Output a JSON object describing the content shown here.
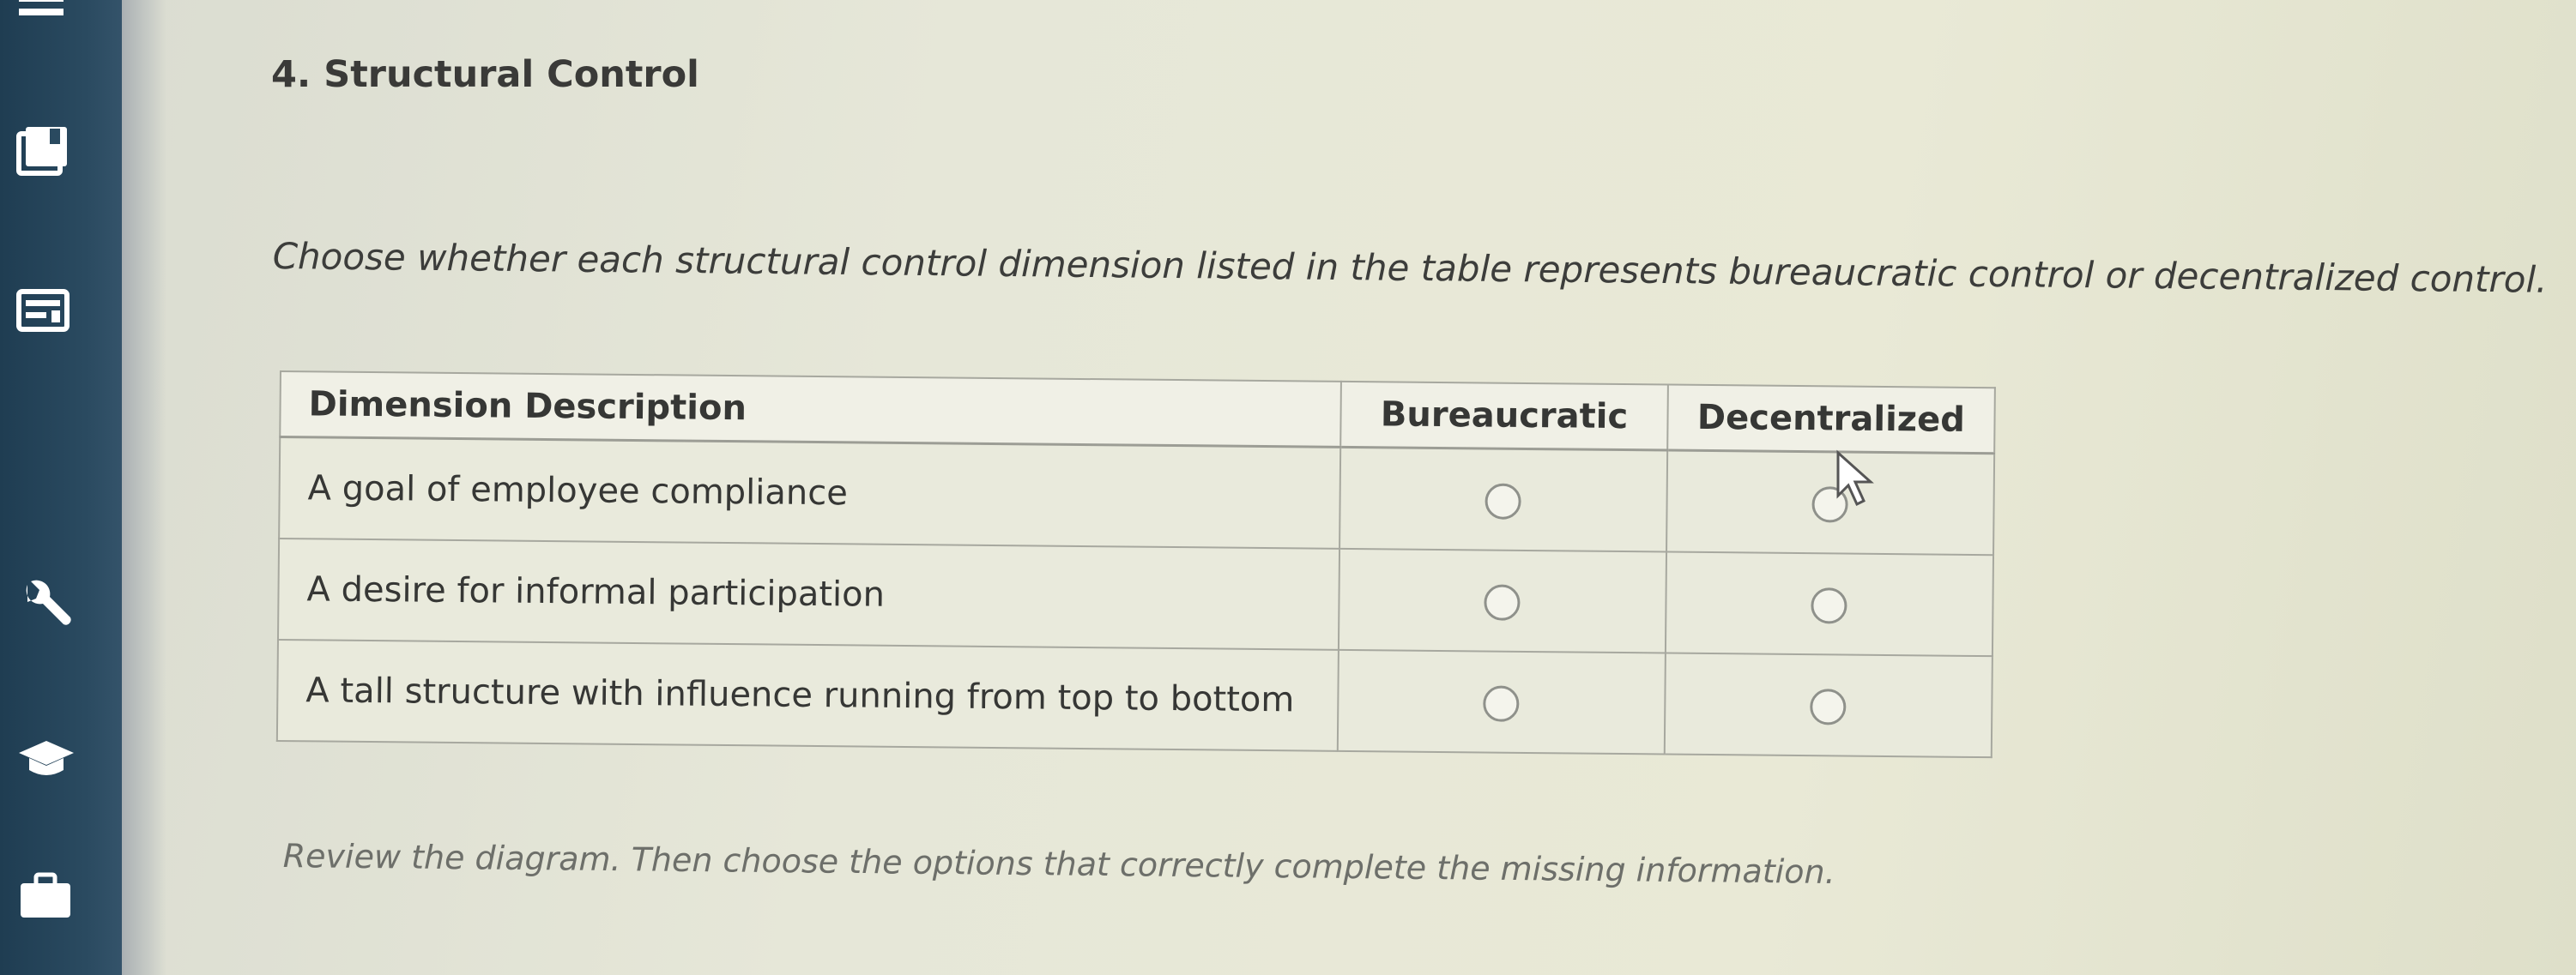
{
  "question": {
    "title": "4. Structural Control",
    "instructions": "Choose whether each structural control dimension listed in the table represents bureaucratic control or decentralized control."
  },
  "table": {
    "headers": {
      "description": "Dimension Description",
      "bureaucratic": "Bureaucratic",
      "decentralized": "Decentralized"
    },
    "rows": [
      {
        "description": "A goal of employee compliance"
      },
      {
        "description": "A desire for informal participation"
      },
      {
        "description": "A tall structure with influence running from top to bottom"
      }
    ]
  },
  "review": {
    "text": "Review the diagram. Then choose the options that correctly complete the missing information."
  },
  "sidebar": {
    "icons": [
      "menu-icon",
      "ebook-icon",
      "calculator-icon",
      "wrench-icon",
      "graduation-cap-icon",
      "briefcase-icon"
    ]
  },
  "colors": {
    "sidebar": "#1f3d52",
    "background": "#e6e7d8",
    "text": "#3a3a38"
  }
}
